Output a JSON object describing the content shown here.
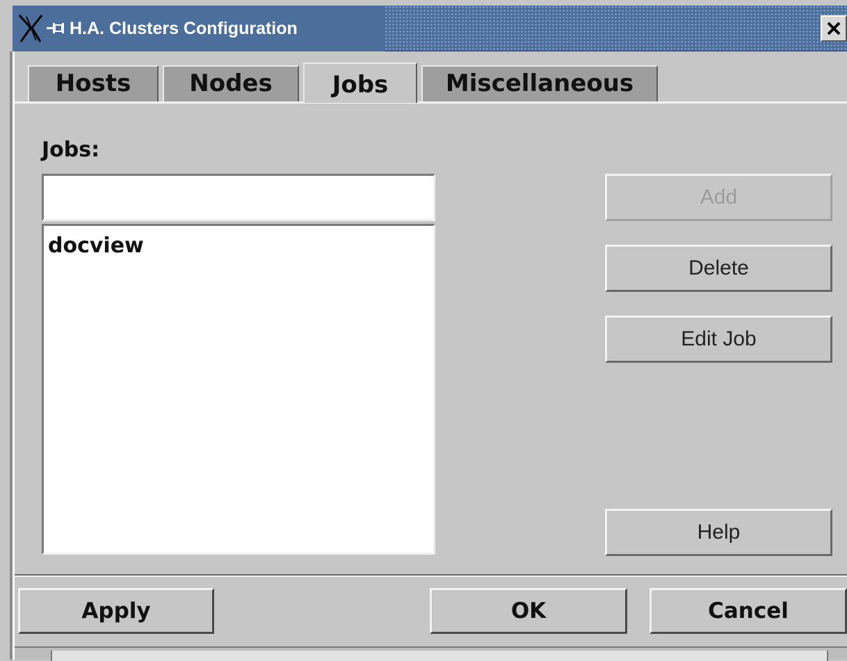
{
  "window": {
    "title": "H.A. Clusters Configuration",
    "title_bar_color": "#4c6e9a"
  },
  "tabs": [
    {
      "label": "Hosts",
      "active": false
    },
    {
      "label": "Nodes",
      "active": false
    },
    {
      "label": "Jobs",
      "active": true
    },
    {
      "label": "Miscellaneous",
      "active": false
    }
  ],
  "jobs": {
    "label": "Jobs:",
    "input_value": "",
    "items": [
      "docview"
    ]
  },
  "side_buttons": {
    "add": "Add",
    "delete": "Delete",
    "edit_job": "Edit Job",
    "help": "Help"
  },
  "bottom_buttons": {
    "apply": "Apply",
    "ok": "OK",
    "cancel": "Cancel"
  }
}
